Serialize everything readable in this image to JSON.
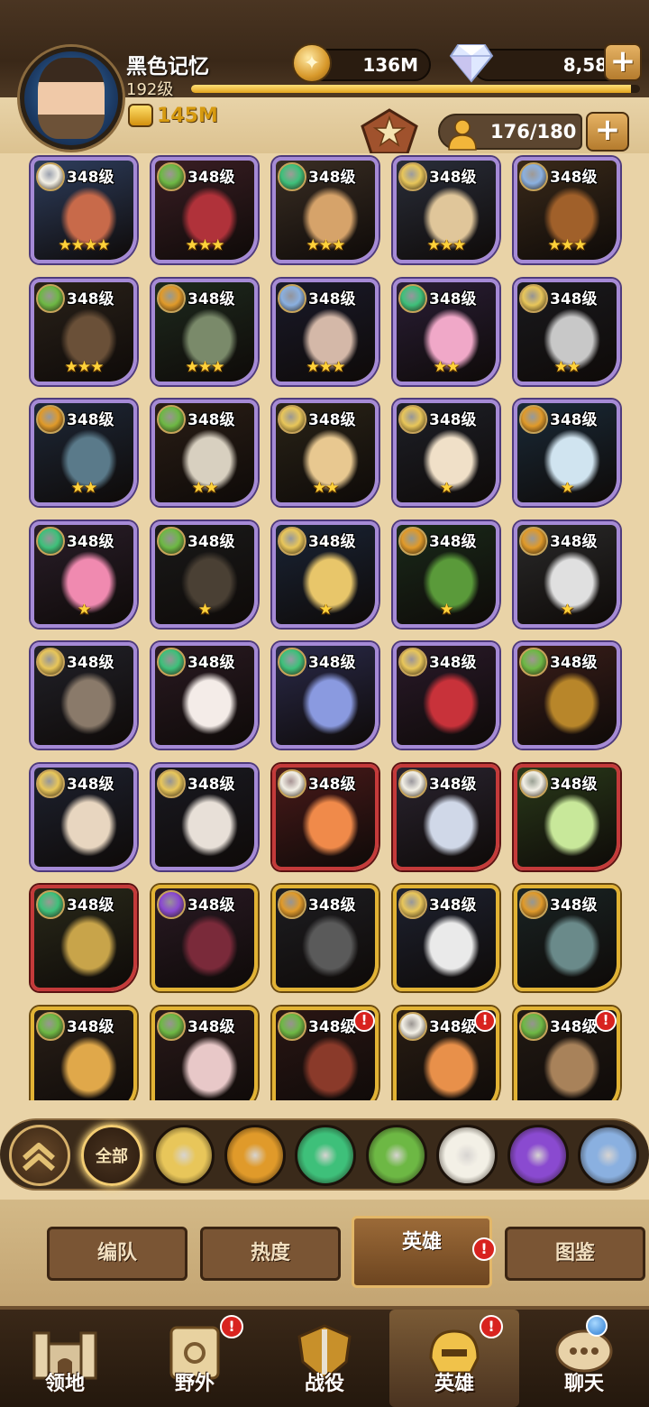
{
  "player": {
    "name": "黑色记忆",
    "level": "192级",
    "power": "145M",
    "xp_progress_percent": 98
  },
  "currency": {
    "gold": "136M",
    "gems": "8,582"
  },
  "hero_count": "176/180",
  "heroes": [
    {
      "level": "348级",
      "faction": "celestial",
      "border": "purple",
      "stars": "★★★★",
      "alert": ""
    },
    {
      "level": "348级",
      "faction": "graveborn",
      "border": "purple",
      "stars": "★★★",
      "alert": ""
    },
    {
      "level": "348级",
      "faction": "wilder",
      "border": "purple",
      "stars": "★★★",
      "alert": ""
    },
    {
      "level": "348级",
      "faction": "lightbearer",
      "border": "purple",
      "stars": "★★★",
      "alert": ""
    },
    {
      "level": "348级",
      "faction": "dimensional",
      "border": "purple",
      "stars": "★★★",
      "alert": ""
    },
    {
      "level": "348级",
      "faction": "graveborn",
      "border": "purple",
      "stars": "★★★",
      "alert": ""
    },
    {
      "level": "348级",
      "faction": "maulers",
      "border": "purple",
      "stars": "★★★",
      "alert": ""
    },
    {
      "level": "348级",
      "faction": "dimensional",
      "border": "purple",
      "stars": "★★★",
      "alert": ""
    },
    {
      "level": "348级",
      "faction": "wilder",
      "border": "purple",
      "stars": "★★",
      "alert": ""
    },
    {
      "level": "348级",
      "faction": "lightbearer",
      "border": "purple",
      "stars": "★★",
      "alert": ""
    },
    {
      "level": "348级",
      "faction": "maulers",
      "border": "purple",
      "stars": "★★",
      "alert": ""
    },
    {
      "level": "348级",
      "faction": "graveborn",
      "border": "purple",
      "stars": "★★",
      "alert": ""
    },
    {
      "level": "348级",
      "faction": "lightbearer",
      "border": "purple",
      "stars": "★★",
      "alert": ""
    },
    {
      "level": "348级",
      "faction": "lightbearer",
      "border": "purple",
      "stars": "★",
      "alert": ""
    },
    {
      "level": "348级",
      "faction": "maulers",
      "border": "purple",
      "stars": "★",
      "alert": ""
    },
    {
      "level": "348级",
      "faction": "wilder",
      "border": "purple",
      "stars": "★",
      "alert": ""
    },
    {
      "level": "348级",
      "faction": "graveborn",
      "border": "purple",
      "stars": "★",
      "alert": ""
    },
    {
      "level": "348级",
      "faction": "lightbearer",
      "border": "purple",
      "stars": "★",
      "alert": ""
    },
    {
      "level": "348级",
      "faction": "maulers",
      "border": "purple",
      "stars": "★",
      "alert": ""
    },
    {
      "level": "348级",
      "faction": "maulers",
      "border": "purple",
      "stars": "★",
      "alert": ""
    },
    {
      "level": "348级",
      "faction": "lightbearer",
      "border": "purple",
      "stars": "",
      "alert": ""
    },
    {
      "level": "348级",
      "faction": "wilder",
      "border": "purple",
      "stars": "",
      "alert": ""
    },
    {
      "level": "348级",
      "faction": "wilder",
      "border": "purple",
      "stars": "",
      "alert": ""
    },
    {
      "level": "348级",
      "faction": "lightbearer",
      "border": "purple",
      "stars": "",
      "alert": ""
    },
    {
      "level": "348级",
      "faction": "graveborn",
      "border": "purple",
      "stars": "",
      "alert": ""
    },
    {
      "level": "348级",
      "faction": "lightbearer",
      "border": "purple",
      "stars": "",
      "alert": ""
    },
    {
      "level": "348级",
      "faction": "lightbearer",
      "border": "purple",
      "stars": "",
      "alert": ""
    },
    {
      "level": "348级",
      "faction": "celestial",
      "border": "red",
      "stars": "",
      "alert": ""
    },
    {
      "level": "348级",
      "faction": "celestial",
      "border": "red",
      "stars": "",
      "alert": ""
    },
    {
      "level": "348级",
      "faction": "celestial",
      "border": "red",
      "stars": "",
      "alert": ""
    },
    {
      "level": "348级",
      "faction": "wilder",
      "border": "red",
      "stars": "",
      "alert": ""
    },
    {
      "level": "348级",
      "faction": "hypogean",
      "border": "gold",
      "stars": "",
      "alert": ""
    },
    {
      "level": "348级",
      "faction": "maulers",
      "border": "gold",
      "stars": "",
      "alert": ""
    },
    {
      "level": "348级",
      "faction": "lightbearer",
      "border": "gold",
      "stars": "",
      "alert": ""
    },
    {
      "level": "348级",
      "faction": "maulers",
      "border": "gold",
      "stars": "",
      "alert": ""
    },
    {
      "level": "348级",
      "faction": "graveborn",
      "border": "gold",
      "stars": "",
      "alert": ""
    },
    {
      "level": "348级",
      "faction": "graveborn",
      "border": "gold",
      "stars": "",
      "alert": ""
    },
    {
      "level": "348级",
      "faction": "graveborn",
      "border": "gold",
      "stars": "",
      "alert": "!"
    },
    {
      "level": "348级",
      "faction": "celestial",
      "border": "gold",
      "stars": "",
      "alert": "!"
    },
    {
      "level": "348级",
      "faction": "graveborn",
      "border": "gold",
      "stars": "",
      "alert": "!"
    }
  ],
  "filters": {
    "all_label": "全部",
    "factions": [
      "lightbearer",
      "maulers",
      "wilder",
      "graveborn",
      "celestial",
      "hypogean",
      "dimensional"
    ]
  },
  "subtabs": [
    "编队",
    "热度",
    "英雄",
    "图鉴"
  ],
  "subtab_alert": "!",
  "nav": [
    {
      "label": "领地",
      "icon": "castle-icon",
      "badge": ""
    },
    {
      "label": "野外",
      "icon": "map-scroll-icon",
      "badge": "!"
    },
    {
      "label": "战役",
      "icon": "sword-shield-icon",
      "badge": ""
    },
    {
      "label": "英雄",
      "icon": "hero-helmet-icon",
      "badge": "!"
    },
    {
      "label": "聊天",
      "icon": "chat-bubble-icon",
      "badge": ""
    }
  ],
  "colors": {
    "lightbearer": "#e8c65a",
    "maulers": "#e09a2a",
    "wilder": "#3ec07a",
    "graveborn": "#6db844",
    "celestial": "#f3f0e6",
    "hypogean": "#8a4ad0",
    "dimensional": "#8ab0e0"
  }
}
